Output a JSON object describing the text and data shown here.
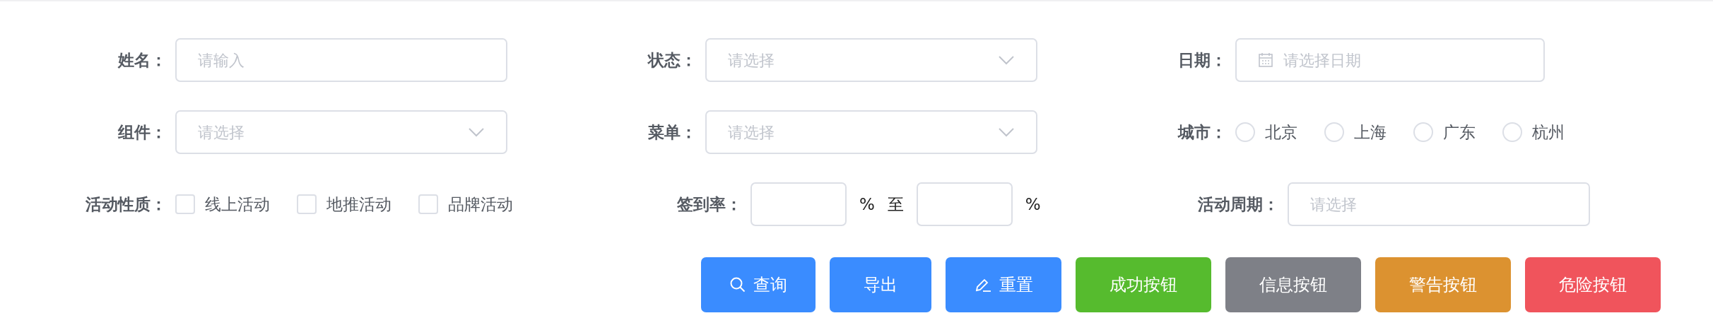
{
  "form": {
    "rows": [
      [
        {
          "kind": "input",
          "label": "姓名：",
          "placeholder": "请输入"
        },
        {
          "kind": "select",
          "label": "状态：",
          "placeholder": "请选择"
        },
        {
          "kind": "date",
          "label": "日期：",
          "placeholder": "请选择日期"
        }
      ],
      [
        {
          "kind": "select",
          "label": "组件：",
          "placeholder": "请选择"
        },
        {
          "kind": "select",
          "label": "菜单：",
          "placeholder": "请选择"
        },
        {
          "kind": "radio",
          "label": "城市：",
          "options": [
            {
              "label": "北京",
              "selected": false
            },
            {
              "label": "上海",
              "selected": false
            },
            {
              "label": "广东",
              "selected": false
            },
            {
              "label": "杭州",
              "selected": false
            }
          ]
        }
      ],
      [
        {
          "kind": "checkbox",
          "label": "活动性质：",
          "options": [
            {
              "label": "线上活动",
              "checked": false
            },
            {
              "label": "地推活动",
              "checked": false
            },
            {
              "label": "品牌活动",
              "checked": false
            }
          ]
        },
        {
          "kind": "range",
          "label": "签到率：",
          "from_unit": "%",
          "separator": "至",
          "to_unit": "%"
        },
        {
          "kind": "input",
          "label": "活动周期：",
          "placeholder": "请选择"
        }
      ]
    ]
  },
  "buttons": [
    {
      "label": "查询",
      "kind": "primary"
    },
    {
      "label": "导出",
      "kind": "primary"
    },
    {
      "label": "重置",
      "kind": "primary"
    },
    {
      "label": "成功按钮",
      "kind": "success"
    },
    {
      "label": "信息按钮",
      "kind": "info"
    },
    {
      "label": "警告按钮",
      "kind": "warning"
    },
    {
      "label": "危险按钮",
      "kind": "danger"
    }
  ]
}
